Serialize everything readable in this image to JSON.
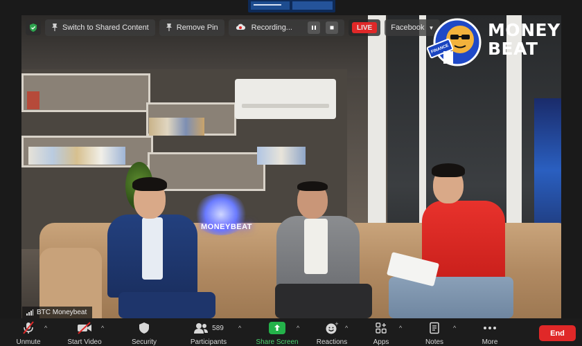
{
  "top_bar": {
    "switch_content_label": "Switch to Shared Content",
    "remove_pin_label": "Remove Pin",
    "recording_label": "Recording...",
    "live_label": "LIVE",
    "stream_target_label": "Facebook"
  },
  "logo": {
    "line1": "MONEY",
    "line2": "BEAT",
    "badge": "FINANCE"
  },
  "scene": {
    "neon_sign": "MONEYBEAT"
  },
  "video": {
    "participant_name": "BTC Moneybeat"
  },
  "toolbar": {
    "unmute_label": "Unmute",
    "start_video_label": "Start Video",
    "security_label": "Security",
    "participants_label": "Participants",
    "participants_count": "589",
    "share_screen_label": "Share Screen",
    "reactions_label": "Reactions",
    "apps_label": "Apps",
    "notes_label": "Notes",
    "more_label": "More",
    "end_label": "End"
  },
  "colors": {
    "live_red": "#e02828",
    "share_green": "#24b24a",
    "toolbar_bg": "#1c1c1c",
    "end_red": "#e02828"
  }
}
